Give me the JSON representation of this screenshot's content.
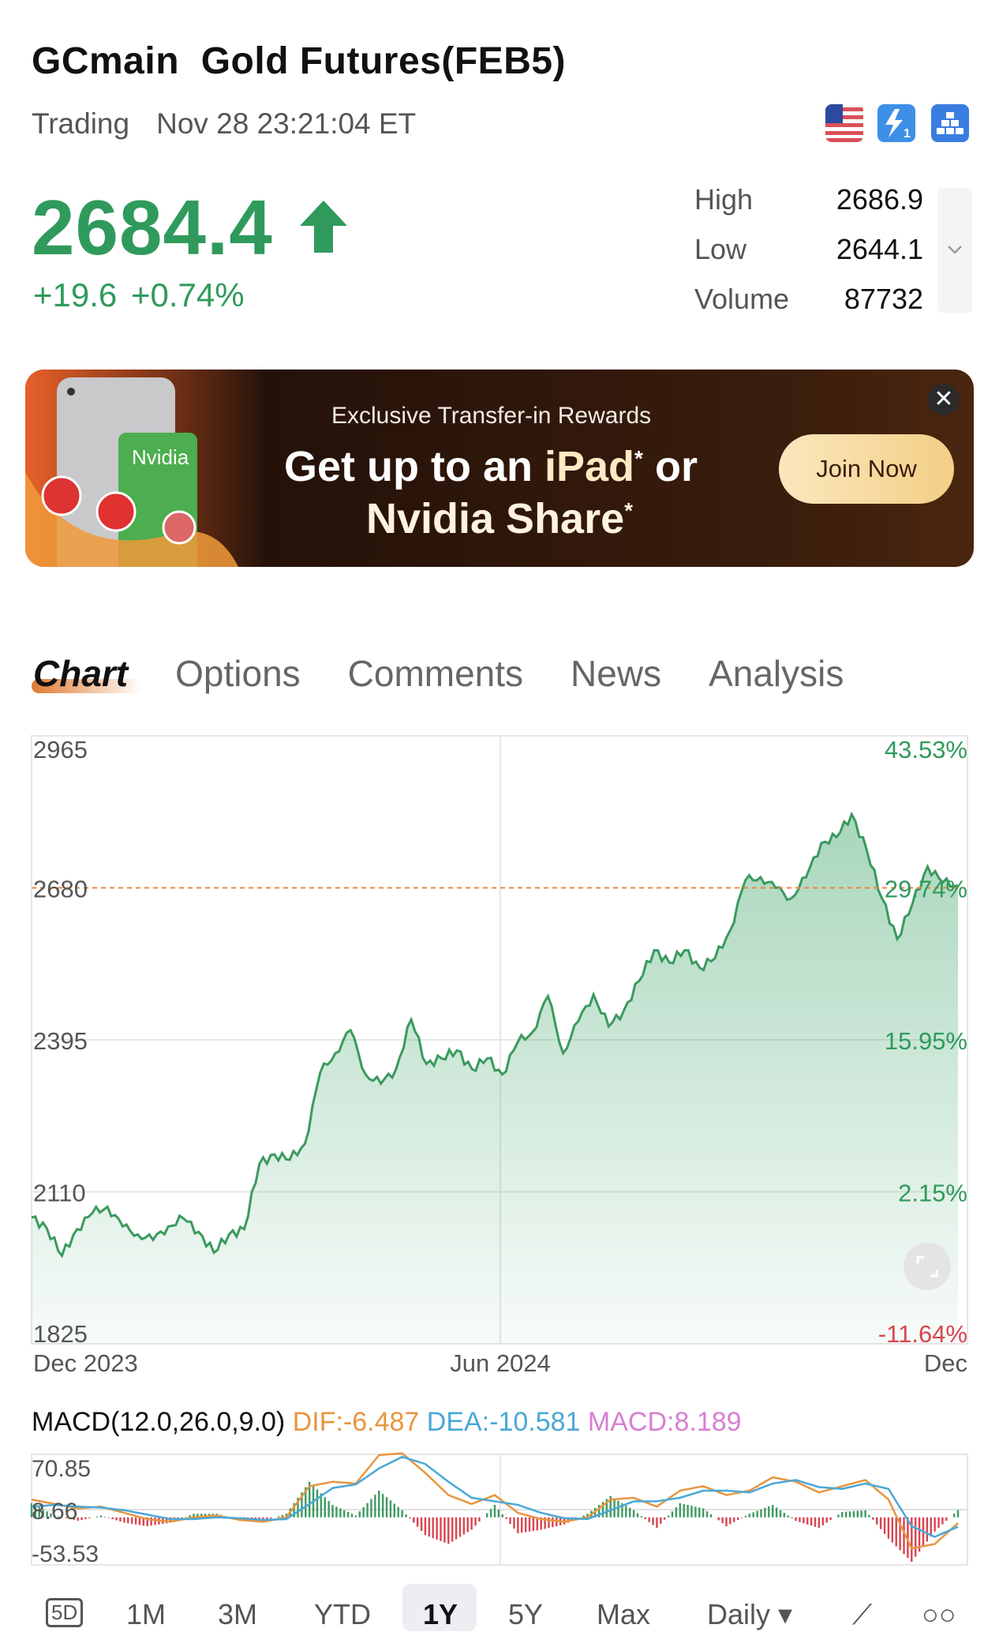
{
  "header": {
    "symbol": "GCmain",
    "name": "Gold Futures(FEB5)",
    "status": "Trading",
    "timestamp": "Nov 28 23:21:04 ET",
    "icons": [
      "us-flag-icon",
      "lightning-level1-icon",
      "gold-bars-icon"
    ]
  },
  "quote": {
    "price": "2684.4",
    "direction": "up",
    "change": "+19.6",
    "change_pct": "+0.74%",
    "high_label": "High",
    "high": "2686.9",
    "low_label": "Low",
    "low": "2644.1",
    "volume_label": "Volume",
    "volume": "87732"
  },
  "banner": {
    "subtitle": "Exclusive Transfer-in Rewards",
    "headline_1": "Get up to an ",
    "headline_ipad": "iPad",
    "headline_or": " or",
    "headline_2": "Nvidia Share",
    "asterisk": "*",
    "button": "Join Now",
    "card_label": "Nvidia"
  },
  "tabs": [
    {
      "label": "Chart",
      "active": true
    },
    {
      "label": "Options"
    },
    {
      "label": "Comments"
    },
    {
      "label": "News"
    },
    {
      "label": "Analysis"
    }
  ],
  "colors": {
    "up": "#2f9a5c",
    "down": "#d9444f",
    "accent": "#e8873a",
    "dif": "#e8953f",
    "dea": "#4aa8d8",
    "macd": "#d77fd3"
  },
  "chart_data": [
    {
      "type": "area",
      "y_ticks_left": [
        "2965",
        "2680",
        "2395",
        "2110",
        "1825"
      ],
      "y_ticks_right": [
        "43.53%",
        "29.74%",
        "15.95%",
        "2.15%",
        "-11.64%"
      ],
      "x_ticks": [
        "Dec 2023",
        "Jun 2024",
        "Dec"
      ],
      "ylim": [
        1825,
        2965
      ],
      "reference_line": 2680,
      "grid": true,
      "values": [
        2062,
        2042,
        1990,
        2040,
        2070,
        2082,
        2045,
        2030,
        2020,
        2045,
        2060,
        2035,
        1996,
        2030,
        2040,
        2162,
        2180,
        2170,
        2200,
        2333,
        2370,
        2413,
        2330,
        2313,
        2340,
        2433,
        2350,
        2360,
        2375,
        2340,
        2360,
        2330,
        2390,
        2410,
        2477,
        2370,
        2430,
        2480,
        2420,
        2450,
        2505,
        2563,
        2540,
        2563,
        2530,
        2548,
        2600,
        2694,
        2700,
        2680,
        2660,
        2700,
        2764,
        2775,
        2818,
        2750,
        2660,
        2584,
        2650,
        2720,
        2690,
        2684.4
      ]
    },
    {
      "type": "macd",
      "title": "MACD(12.0,26.0,9.0)",
      "dif_label": "DIF:-6.487",
      "dea_label": "DEA:-10.581",
      "macd_label": "MACD:8.189",
      "y_ticks": [
        "70.85",
        "8.66",
        "-53.53"
      ],
      "ylim": [
        -53.53,
        70.85
      ],
      "dif": [
        20,
        15,
        10,
        12,
        5,
        -2,
        -5,
        0,
        2,
        -3,
        -5,
        0,
        35,
        40,
        38,
        70,
        72,
        50,
        25,
        15,
        25,
        5,
        -2,
        -5,
        0,
        20,
        22,
        12,
        30,
        35,
        25,
        30,
        45,
        40,
        28,
        35,
        42,
        20,
        -35,
        -30,
        -6.487
      ],
      "dea": [
        12,
        14,
        12,
        11,
        8,
        3,
        -2,
        -2,
        0,
        -1,
        -3,
        -2,
        15,
        33,
        37,
        55,
        68,
        60,
        40,
        22,
        18,
        14,
        5,
        -1,
        -2,
        8,
        18,
        18,
        22,
        30,
        30,
        28,
        38,
        42,
        34,
        32,
        38,
        32,
        -10,
        -22,
        -10.581
      ]
    }
  ],
  "periods": {
    "items": [
      "5D",
      "1M",
      "3M",
      "YTD",
      "1Y",
      "5Y",
      "Max",
      "Daily ▾"
    ],
    "selected": "1Y"
  }
}
